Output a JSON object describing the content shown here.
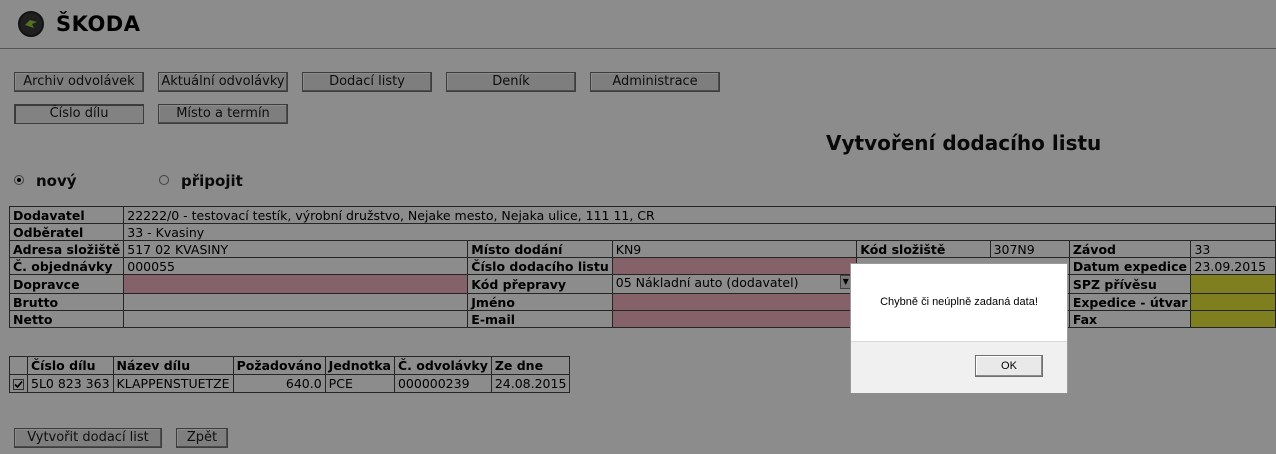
{
  "brand": {
    "name": "ŠKODA",
    "logo_icon": "skoda-winged-arrow-icon"
  },
  "nav": {
    "tabs": [
      {
        "label": "Archiv odvolávek"
      },
      {
        "label": "Aktuální odvolávky"
      },
      {
        "label": "Dodací listy"
      },
      {
        "label": "Deník"
      },
      {
        "label": "Administrace"
      }
    ],
    "subtabs": [
      {
        "label": "Číslo dílu"
      },
      {
        "label": "Místo a termín"
      }
    ]
  },
  "page_title": "Vytvoření dodacího listu",
  "mode": {
    "options": [
      "nový",
      "připojit"
    ],
    "selected": "nový"
  },
  "form": {
    "dodavatel": {
      "label": "Dodavatel",
      "value": "22222/0  -  testovací testík, výrobní družstvo,   Nejake mesto,   Nejaka ulice,   111 11,   CR"
    },
    "odberatel": {
      "label": "Odběratel",
      "value": "33 - Kvasiny"
    },
    "adresa": {
      "label": "Adresa složiště",
      "value": "517 02 KVASINY"
    },
    "misto": {
      "label": "Místo dodání",
      "value": "KN9"
    },
    "kod_sloziste": {
      "label": "Kód složiště",
      "value": "307N9"
    },
    "zavod": {
      "label": "Závod",
      "value": "33"
    },
    "objednavka": {
      "label": "Č. objednávky",
      "value": "000055"
    },
    "cislo_dl": {
      "label": "Číslo dodacího listu",
      "value": ""
    },
    "datum_expedice": {
      "label": "Datum expedice",
      "value": "23.09.2015"
    },
    "dopravce": {
      "label": "Dopravce",
      "value": ""
    },
    "kod_prepravy": {
      "label": "Kód přepravy",
      "value": "05 Nákladní auto (dodavatel)"
    },
    "spz": {
      "label": "SPZ přívěsu",
      "value": ""
    },
    "brutto": {
      "label": "Brutto",
      "value": ""
    },
    "jmeno": {
      "label": "Jméno",
      "value": ""
    },
    "expedice_utvar": {
      "label": "Expedice - útvar",
      "value": ""
    },
    "netto": {
      "label": "Netto",
      "value": ""
    },
    "email": {
      "label": "E-mail",
      "value": ""
    },
    "fax": {
      "label": "Fax",
      "value": ""
    }
  },
  "items": {
    "headers": [
      "Číslo dílu",
      "Název dílu",
      "Požadováno",
      "Jednotka",
      "Č. odvolávky",
      "Ze dne"
    ],
    "rows": [
      {
        "checked": true,
        "cells": [
          "5L0 823 363",
          "KLAPPENSTUETZE",
          "640.0",
          "PCE",
          "000000239",
          "24.08.2015"
        ]
      }
    ]
  },
  "actions": {
    "create_label": "Vytvořit dodací list",
    "back_label": "Zpět"
  },
  "dialog": {
    "message": "Chybně či neúplně zadaná data!",
    "ok_label": "OK"
  },
  "colors": {
    "required": "#f2b3bf",
    "highlight": "#e8e83a",
    "overlay": "rgba(0,0,0,0.45)"
  }
}
